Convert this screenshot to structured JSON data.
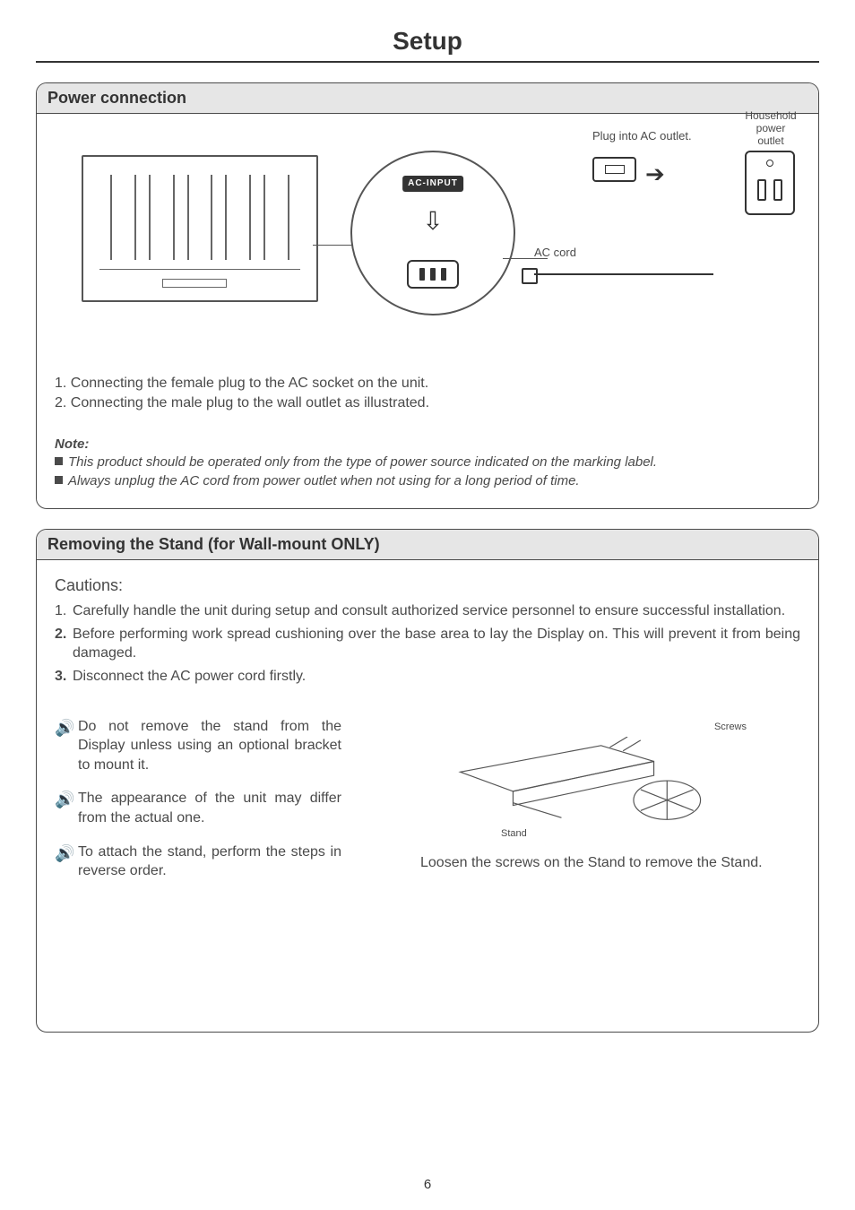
{
  "page": {
    "title": "Setup",
    "number": "6"
  },
  "power": {
    "header": "Power connection",
    "ac_input_label": "AC-INPUT",
    "ac_cord": "AC cord",
    "plug_into": "Plug into AC outlet.",
    "outlet_caption": "Household power outlet",
    "step1": "1. Connecting the female plug to the AC socket on the unit.",
    "step2": "2. Connecting the male plug to the wall outlet as illustrated.",
    "note_title": "Note:",
    "note1": "This product should be operated only from the type of power source indicated on the marking label.",
    "note2": "Always unplug the AC cord from power outlet when not using for a long period of time."
  },
  "stand": {
    "header": "Removing the Stand (for Wall-mount ONLY)",
    "cautions_title": "Cautions:",
    "c1": "Carefully handle the unit during setup and consult authorized service personnel to ensure successful installation.",
    "c2_lead": "2.",
    "c2": "Before performing work spread cushioning over the base area to lay the Display on. This will prevent it from being damaged.",
    "c3_lead": "3.",
    "c3": "Disconnect the AC power cord firstly.",
    "tip1": "Do not remove the stand  from the Display unless using an optional bracket to mount it.",
    "tip2": "The appearance of the unit may differ from the actual one.",
    "tip3": "To attach the stand, perform the steps in reverse order.",
    "label_screws": "Screws",
    "label_stand": "Stand",
    "stand_caption": "Loosen the screws on the Stand to remove the Stand."
  }
}
